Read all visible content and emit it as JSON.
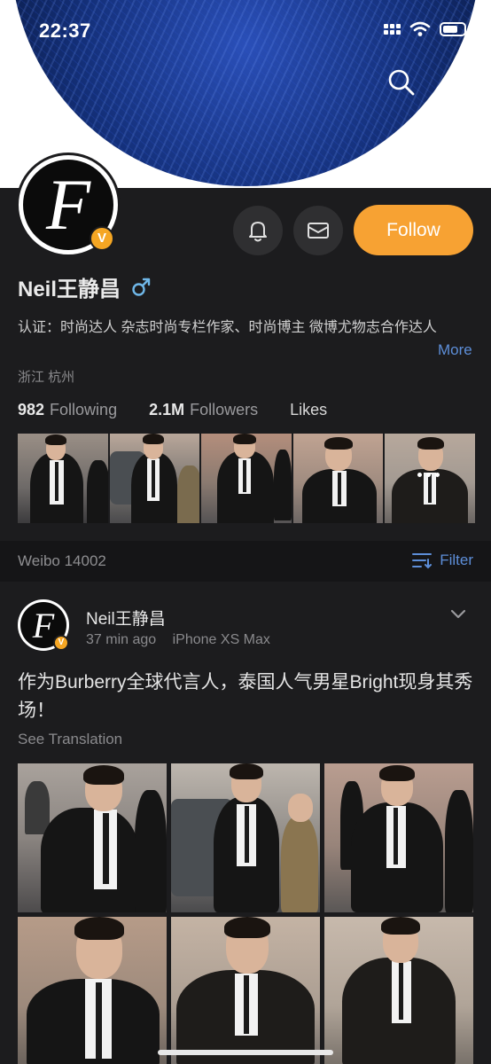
{
  "status_bar": {
    "time": "22:37"
  },
  "nav": {
    "back_icon": "chevron-left-icon",
    "search_icon": "search-icon",
    "more_icon": "ellipsis-icon"
  },
  "profile": {
    "avatar_letter": "F",
    "verified_badge": "V",
    "name": "Neil王静昌",
    "gender_icon": "male-icon",
    "bell_icon": "bell-icon",
    "message_icon": "mail-icon",
    "follow_label": "Follow",
    "bio": "认证：时尚达人 杂志时尚专栏作家、时尚博主 微博尤物志合作达人",
    "bio_more": "More",
    "location": "浙江 杭州",
    "following_count": "982",
    "following_label": "Following",
    "followers_count": "2.1M",
    "followers_label": "Followers",
    "likes_label": "Likes",
    "colors": {
      "accent": "#f7a233",
      "link": "#5d8ed8",
      "background": "#1c1c1e"
    }
  },
  "weibo_bar": {
    "count_label": "Weibo 14002",
    "filter_label": "Filter",
    "filter_icon": "filter-icon"
  },
  "post": {
    "author": "Neil王静昌",
    "time": "37 min ago",
    "device": "iPhone XS Max",
    "text": "作为Burberry全球代言人，泰国人气男星Bright现身其秀场！",
    "see_translation": "See Translation",
    "chevron_icon": "chevron-down-icon"
  }
}
